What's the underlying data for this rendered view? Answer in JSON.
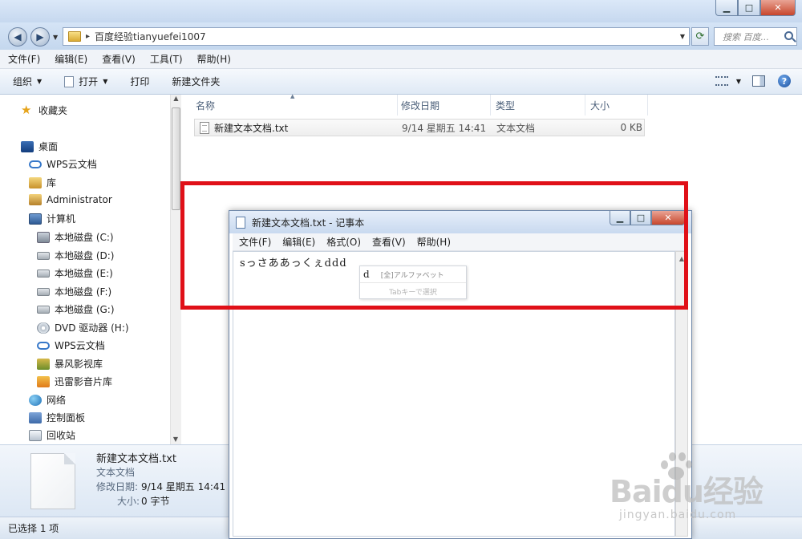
{
  "explorer": {
    "window_controls": {
      "minimize": "▁",
      "maximize": "□",
      "close": "✕"
    },
    "address": {
      "path": "百度经验tianyuefei1007",
      "search_placeholder": "搜索 百度..."
    },
    "menu": [
      "文件(F)",
      "编辑(E)",
      "查看(V)",
      "工具(T)",
      "帮助(H)"
    ],
    "toolbar": {
      "organize": "组织",
      "open": "打开",
      "print": "打印",
      "new_folder": "新建文件夹"
    },
    "nav": {
      "favorites": "收藏夹",
      "desktop": "桌面",
      "wps_cloud": "WPS云文档",
      "library": "库",
      "admin": "Administrator",
      "computer": "计算机",
      "disk_c": "本地磁盘 (C:)",
      "disk_d": "本地磁盘 (D:)",
      "disk_e": "本地磁盘 (E:)",
      "disk_f": "本地磁盘 (F:)",
      "disk_g": "本地磁盘 (G:)",
      "dvd": "DVD 驱动器 (H:)",
      "wps_cloud2": "WPS云文档",
      "storm": "暴风影视库",
      "thunder": "迅雷影音片库",
      "network": "网络",
      "control_panel": "控制面板",
      "recycle_bin": "回收站"
    },
    "columns": {
      "name": "名称",
      "date": "修改日期",
      "type": "类型",
      "size": "大小"
    },
    "file": {
      "name": "新建文本文档.txt",
      "date": "9/14 星期五 14:41",
      "type": "文本文档",
      "size": "0 KB"
    },
    "details": {
      "name": "新建文本文档.txt",
      "type": "文本文档",
      "modified_label": "修改日期:",
      "modified": "9/14 星期五 14:41",
      "size_label": "大小:",
      "size": "0 字节"
    },
    "status": "已选择 1 项"
  },
  "notepad": {
    "title": "新建文本文档.txt - 记事本",
    "menu": [
      "文件(F)",
      "编辑(E)",
      "格式(O)",
      "查看(V)",
      "帮助(H)"
    ],
    "text": "sっさああっくぇddd",
    "ime": {
      "candidate": "d",
      "hint": "[全]アルファベット",
      "tab_hint": "Tabキーで選択"
    }
  },
  "watermark": {
    "brand": "Baidu经验",
    "url": "jingyan.baidu.com"
  },
  "colors": {
    "highlight_border": "#e01018",
    "window_frame": "#c8daf0"
  }
}
